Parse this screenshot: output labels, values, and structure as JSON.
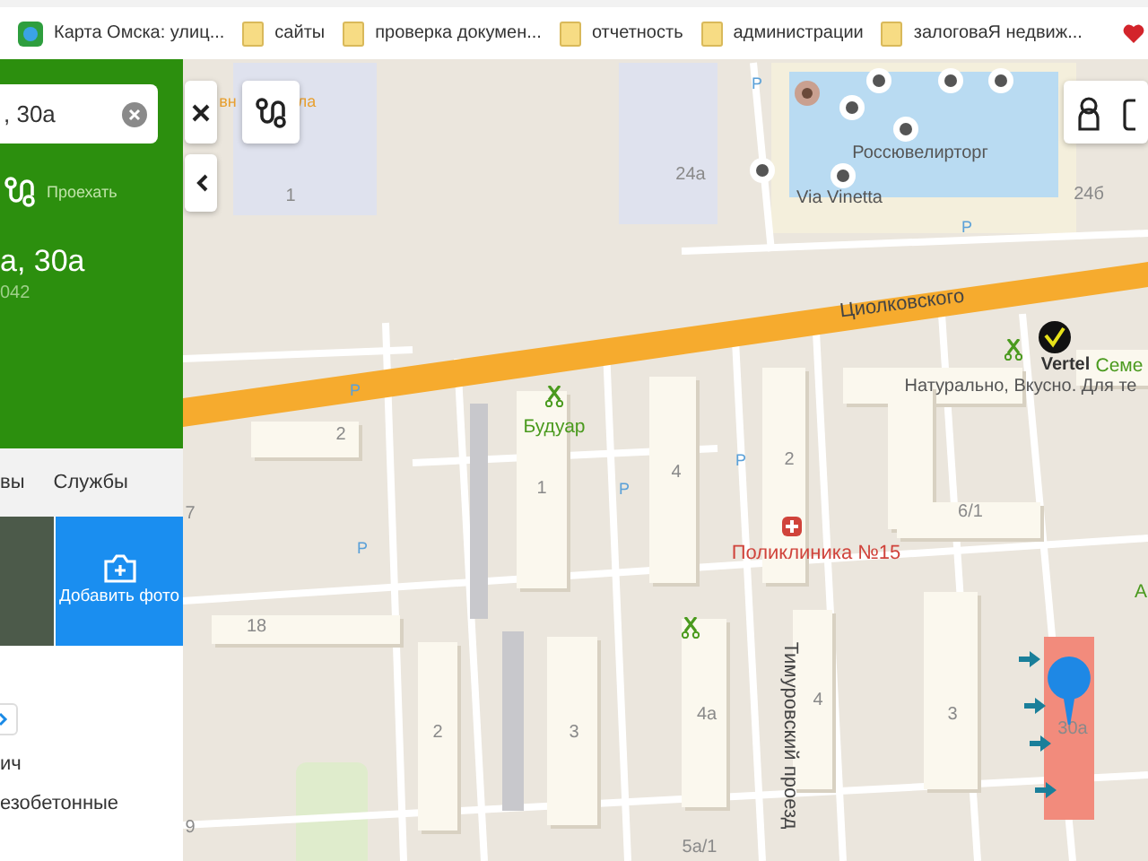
{
  "bookmarks": [
    {
      "label": "Карта Омска: улиц...",
      "kind": "site"
    },
    {
      "label": "сайты",
      "kind": "folder"
    },
    {
      "label": "проверка докумен...",
      "kind": "folder"
    },
    {
      "label": "отчетность",
      "kind": "folder"
    },
    {
      "label": "администрации",
      "kind": "folder"
    },
    {
      "label": "залоговаЯ недвиж...",
      "kind": "folder"
    }
  ],
  "sidebar": {
    "search": {
      "value": ", 30а"
    },
    "route_label": "Проехать",
    "title": "а, 30а",
    "subtitle": "042",
    "tabs": [
      {
        "label": "вы",
        "selected": false
      },
      {
        "label": "Службы",
        "selected": false
      }
    ],
    "add_photo": "Добавить фото",
    "lines": [
      "ич",
      "езобетонные"
    ]
  },
  "map": {
    "labels": [
      {
        "text": "вн",
        "kind": "orange"
      },
      {
        "text": "ла",
        "kind": "orange"
      },
      {
        "text": "1",
        "kind": "building"
      },
      {
        "text": "24а",
        "kind": "building"
      },
      {
        "text": "Россювелирторг",
        "kind": "poi"
      },
      {
        "text": "Via Vinetta",
        "kind": "poi"
      },
      {
        "text": "24б",
        "kind": "building"
      },
      {
        "text": "Циолковского",
        "kind": "street"
      },
      {
        "text": "Vertel",
        "kind": "bold"
      },
      {
        "text": "Семе",
        "kind": "green"
      },
      {
        "text": "Натурально, Вкусно. Для те",
        "kind": "poi"
      },
      {
        "text": "2",
        "kind": "building"
      },
      {
        "text": "Будуар",
        "kind": "green"
      },
      {
        "text": "1",
        "kind": "building"
      },
      {
        "text": "4",
        "kind": "building"
      },
      {
        "text": "2",
        "kind": "building"
      },
      {
        "text": "6/1",
        "kind": "building"
      },
      {
        "text": "Поликлиника №15",
        "kind": "red"
      },
      {
        "text": "18",
        "kind": "building"
      },
      {
        "text": "2",
        "kind": "building"
      },
      {
        "text": "3",
        "kind": "building"
      },
      {
        "text": "4а",
        "kind": "building"
      },
      {
        "text": "Тимуровский проезд",
        "kind": "street"
      },
      {
        "text": "4",
        "kind": "building"
      },
      {
        "text": "3",
        "kind": "building"
      },
      {
        "text": "30а",
        "kind": "building"
      },
      {
        "text": "5а/1",
        "kind": "building"
      },
      {
        "text": "7",
        "kind": "building"
      },
      {
        "text": "9",
        "kind": "building"
      },
      {
        "text": "А",
        "kind": "green"
      },
      {
        "text": "P",
        "kind": "parking"
      },
      {
        "text": "P",
        "kind": "parking"
      },
      {
        "text": "P",
        "kind": "parking"
      },
      {
        "text": "P",
        "kind": "parking"
      },
      {
        "text": "P",
        "kind": "parking"
      },
      {
        "text": "P",
        "kind": "parking"
      }
    ]
  }
}
